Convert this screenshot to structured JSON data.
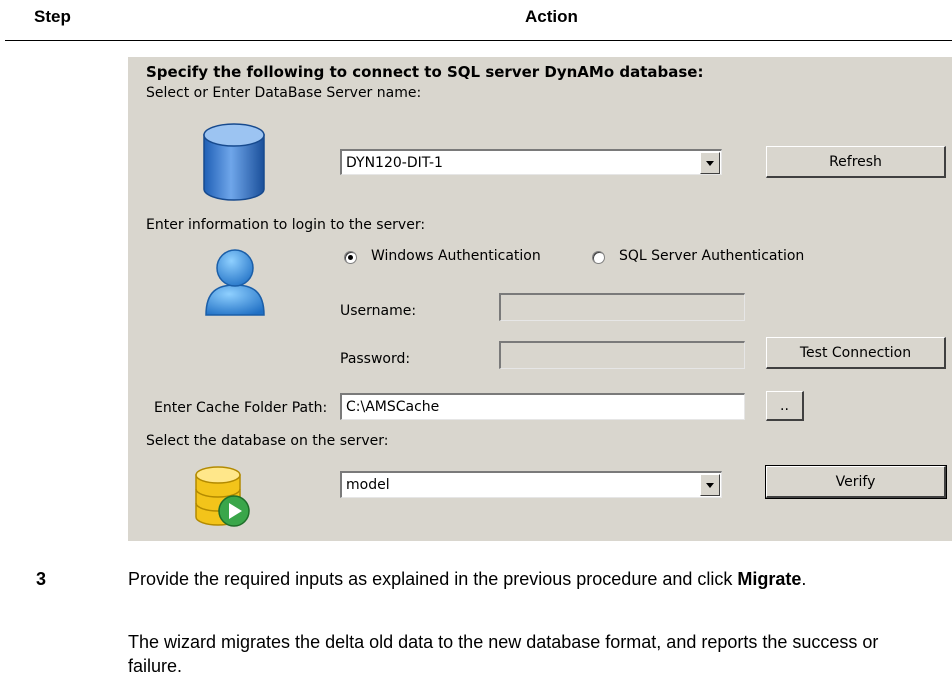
{
  "table_header": {
    "step": "Step",
    "action": "Action"
  },
  "dialog": {
    "title": "Specify the following to connect to SQL server DynAMo database:",
    "server_prompt": "Select or Enter DataBase Server name:",
    "server_value": "DYN120-DIT-1",
    "refresh_label": "Refresh",
    "login_prompt": "Enter information to login to the server:",
    "windows_auth_label": "Windows Authentication",
    "sql_auth_label": "SQL Server Authentication",
    "selected_auth": "Windows Authentication",
    "username_label": "Username:",
    "username_value": "",
    "password_label": "Password:",
    "password_value": "",
    "test_connection_label": "Test Connection",
    "cache_label": "Enter Cache Folder Path:",
    "cache_value": "C:\\AMSCache",
    "browse_label": "..",
    "database_prompt": "Select the database on the server:",
    "database_value": "model",
    "verify_label": "Verify"
  },
  "step": {
    "number": "3",
    "instruction_prefix": "Provide the required inputs as explained in the previous procedure and click ",
    "instruction_bold": "Migrate",
    "instruction_suffix": ".",
    "result": "The wizard migrates the delta old data to the new database format, and reports the success or failure."
  },
  "colors": {
    "panel": "#d9d6ce",
    "db_icon": "#3b7bd0",
    "user_icon": "#2f8be0",
    "db_select_icon": "#f2c200",
    "play_icon": "#3aa64a"
  }
}
